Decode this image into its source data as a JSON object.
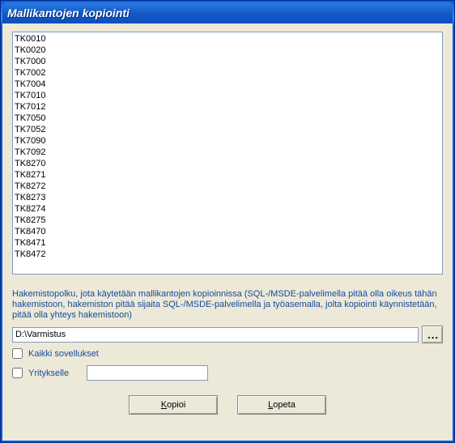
{
  "titlebar": {
    "title": "Mallikantojen kopiointi"
  },
  "list": {
    "items": [
      "TK0010",
      "TK0020",
      "TK7000",
      "TK7002",
      "TK7004",
      "TK7010",
      "TK7012",
      "TK7050",
      "TK7052",
      "TK7090",
      "TK7092",
      "TK8270",
      "TK8271",
      "TK8272",
      "TK8273",
      "TK8274",
      "TK8275",
      "TK8470",
      "TK8471",
      "TK8472"
    ]
  },
  "description": "Hakemistopolku, jota käytetään mallikantojen kopioinnissa (SQL-/MSDE-palvelimella pitää olla oikeus tähän hakemistoon, hakemiston pitää sijaita SQL-/MSDE-palvelimella ja työasemalla, jolta kopiointi käynnistetään, pitää olla yhteys hakemistoon)",
  "path": {
    "value": "D:\\Varmistus",
    "browse_label": "..."
  },
  "checks": {
    "all_apps": {
      "label": "Kaikki sovellukset",
      "checked": false
    },
    "for_company": {
      "label": "Yritykselle",
      "checked": false,
      "value": ""
    }
  },
  "buttons": {
    "copy_prefix": "K",
    "copy_rest": "opioi",
    "quit_prefix": "L",
    "quit_rest": "opeta"
  }
}
